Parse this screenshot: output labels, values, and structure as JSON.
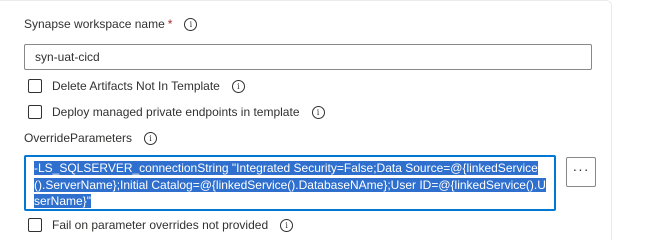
{
  "workspace": {
    "label": "Synapse workspace name",
    "required_mark": "*",
    "value": "syn-uat-cicd"
  },
  "checkboxes": {
    "delete_artifacts": "Delete Artifacts Not In Template",
    "deploy_private_endpoints": "Deploy managed private endpoints in template",
    "fail_on_overrides": "Fail on parameter overrides not provided"
  },
  "override": {
    "label": "OverrideParameters",
    "value": "-LS_SQLSERVER_connectionString \"Integrated Security=False;Data Source=@{linkedService().ServerName};Initial Catalog=@{linkedService().DatabaseNAme};User ID=@{linkedService().UserName}\"",
    "more_button": "···"
  },
  "icons": {
    "info": "info-icon",
    "more": "ellipsis-icon"
  }
}
